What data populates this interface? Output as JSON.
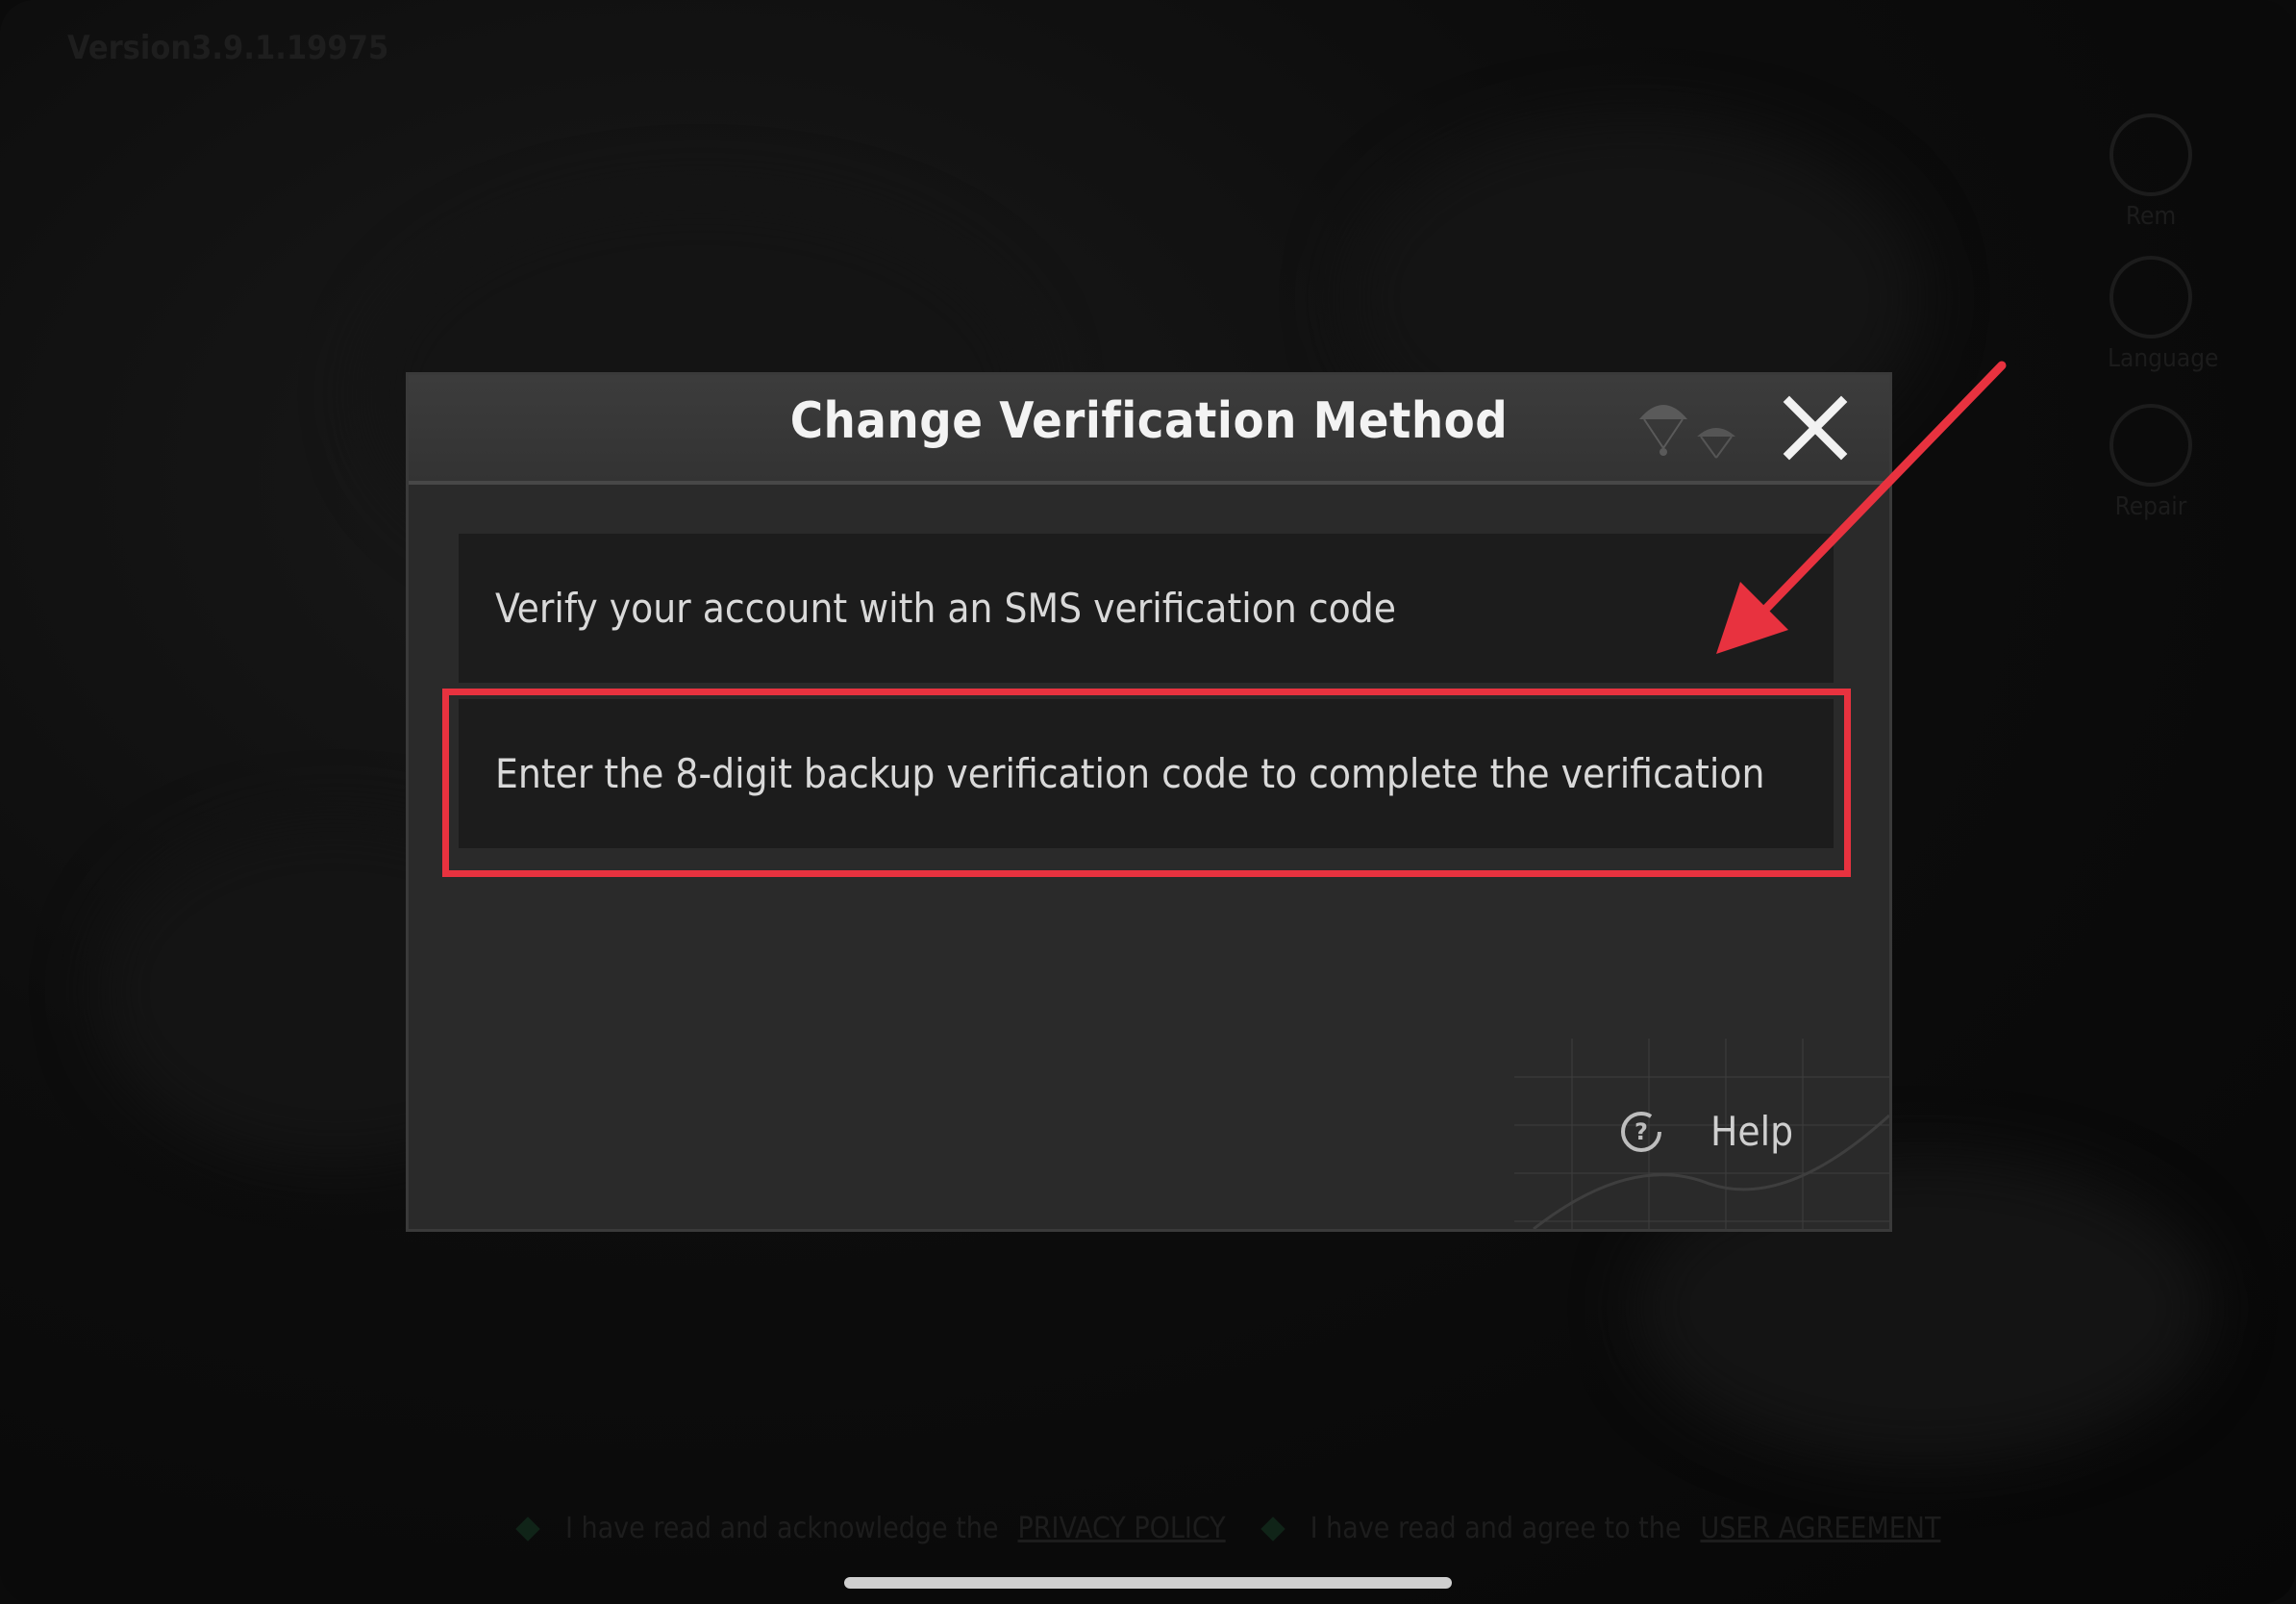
{
  "background": {
    "version_label": "Version3.9.1.19975",
    "side_buttons": [
      "Rem",
      "Language",
      "Repair"
    ],
    "legal": {
      "privacy_prefix": "I have read and acknowledge the",
      "privacy_link": "PRIVACY POLICY",
      "agreement_prefix": "I have read and agree to the",
      "agreement_link": "USER AGREEMENT"
    }
  },
  "dialog": {
    "title": "Change Verification Method",
    "close_icon": "close-icon",
    "options": [
      "Verify your account with an SMS verification code",
      "Enter the 8-digit backup verification code to complete the verification"
    ],
    "help_label": "Help",
    "help_icon": "question-icon"
  },
  "annotation": {
    "highlight_color": "#e8323f",
    "arrow_color": "#e8323f",
    "accent_edge_color": "#2cc7d8"
  }
}
